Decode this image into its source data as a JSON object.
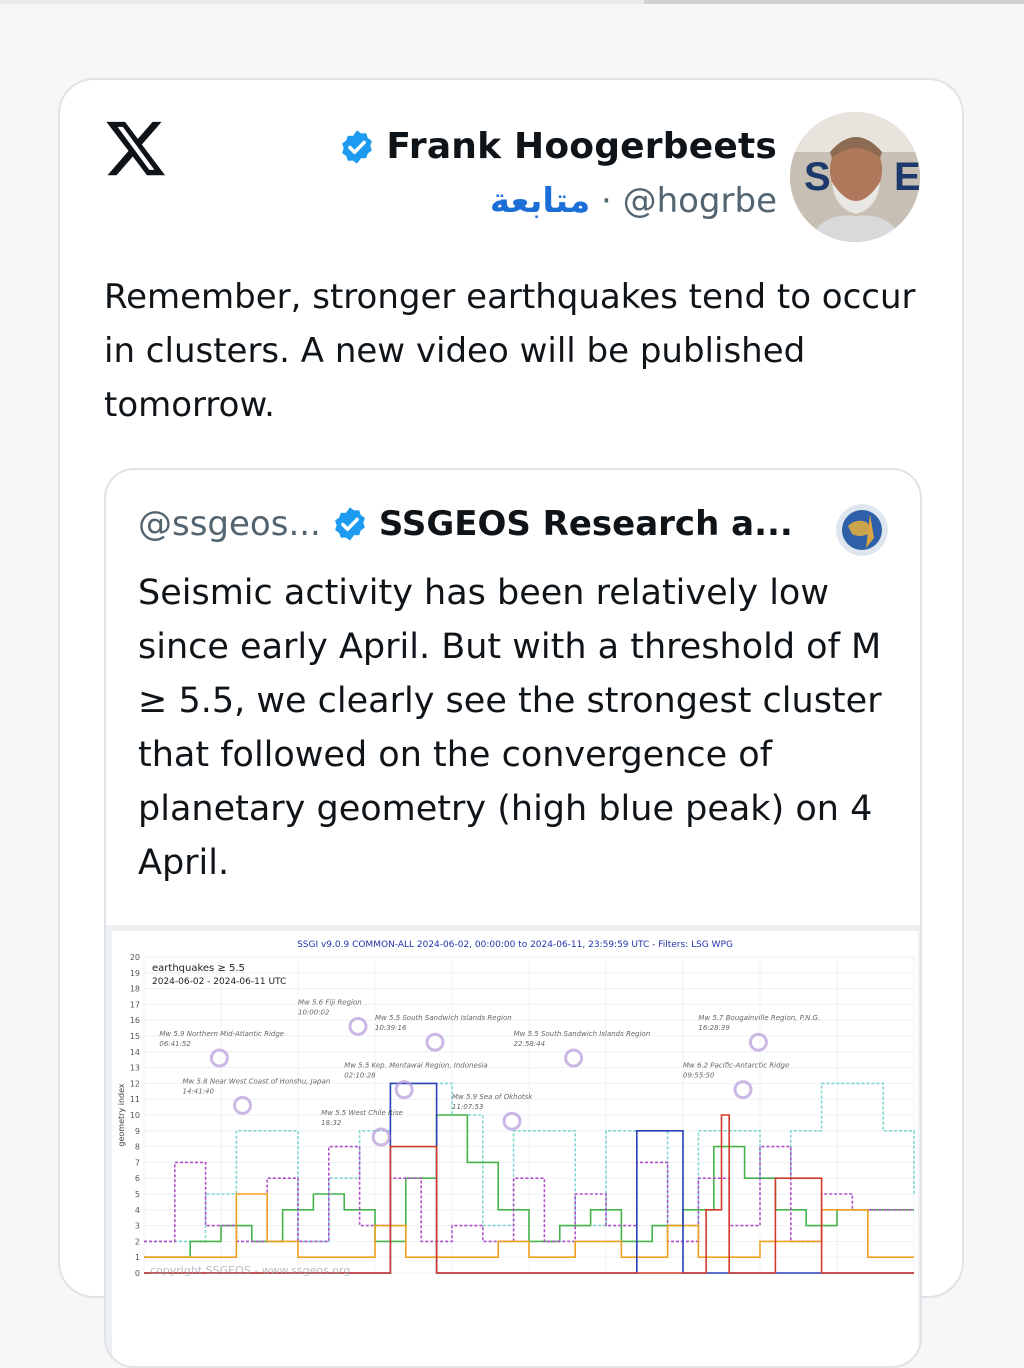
{
  "tweet": {
    "author_name": "Frank Hoogerbeets",
    "follow_label": "متابعة",
    "separator": "·",
    "handle": "@hogrbe",
    "text": "Remember, stronger earthquakes tend to occur in clusters. A new video will be published tomorrow."
  },
  "quoted": {
    "handle": "@ssgeos...",
    "name": "SSGEOS Research a...",
    "text": "Seismic activity has been relatively low since early April. But with a threshold of M ≥ 5.5, we clearly see the strongest cluster that followed on the convergence of planetary geometry (high blue peak) on 4 April.",
    "media": {
      "title": "SSGI v9.0.9 COMMON-ALL 2024-06-02, 00:00:00 to 2024-06-11, 23:59:59 UTC - Filters: LSG WPG",
      "legend_line1": "earthquakes ≥ 5.5",
      "legend_line2": "2024-06-02 - 2024-06-11 UTC",
      "ylabel": "geometry index",
      "watermark": "copyright SSGEOS - www.ssgeos.org",
      "yticks": [
        "20",
        "19",
        "18",
        "17",
        "16",
        "15",
        "14",
        "13",
        "12",
        "11",
        "10",
        "9",
        "8",
        "7",
        "6",
        "5",
        "4",
        "3",
        "2",
        "1",
        "0"
      ],
      "annotations": [
        {
          "text": "Mw 5.6 Fiji Region",
          "time": "10:00:02"
        },
        {
          "text": "Mw 5.5 South Sandwich Islands Region",
          "time": "10:39:16"
        },
        {
          "text": "Mw 5.5 South Sandwich Islands Region",
          "time": "22:58:44"
        },
        {
          "text": "Mw 5.7 Bougainville Region, P.N.G.",
          "time": "16:28:39"
        },
        {
          "text": "Mw 5.9 Northern Mid-Atlantic Ridge",
          "time": "06:41:52"
        },
        {
          "text": "Mw 5.5 Kep. Mentawai Region, Indonesia",
          "time": "02:10:28"
        },
        {
          "text": "Mw 6.2 Pacific-Antarctic Ridge",
          "time": "09:55:50"
        },
        {
          "text": "Mw 5.8 Near West Coast of Honshu, Japan",
          "time": "14:41:40"
        },
        {
          "text": "Mw 5.9 Sea of Okhotsk",
          "time": "11:07:53"
        },
        {
          "text": "Mw 5.5 West Chile Rise",
          "time": "18:32"
        }
      ]
    }
  },
  "colors": {
    "verified": "#1d9bf0",
    "follow": "#1d6fd8",
    "line_blue": "#2a3fb8",
    "line_red": "#d23a2a",
    "line_green": "#46b34a",
    "line_orange": "#f0a020",
    "line_teal": "#7fd6cf",
    "line_purple": "#b04fc8"
  }
}
